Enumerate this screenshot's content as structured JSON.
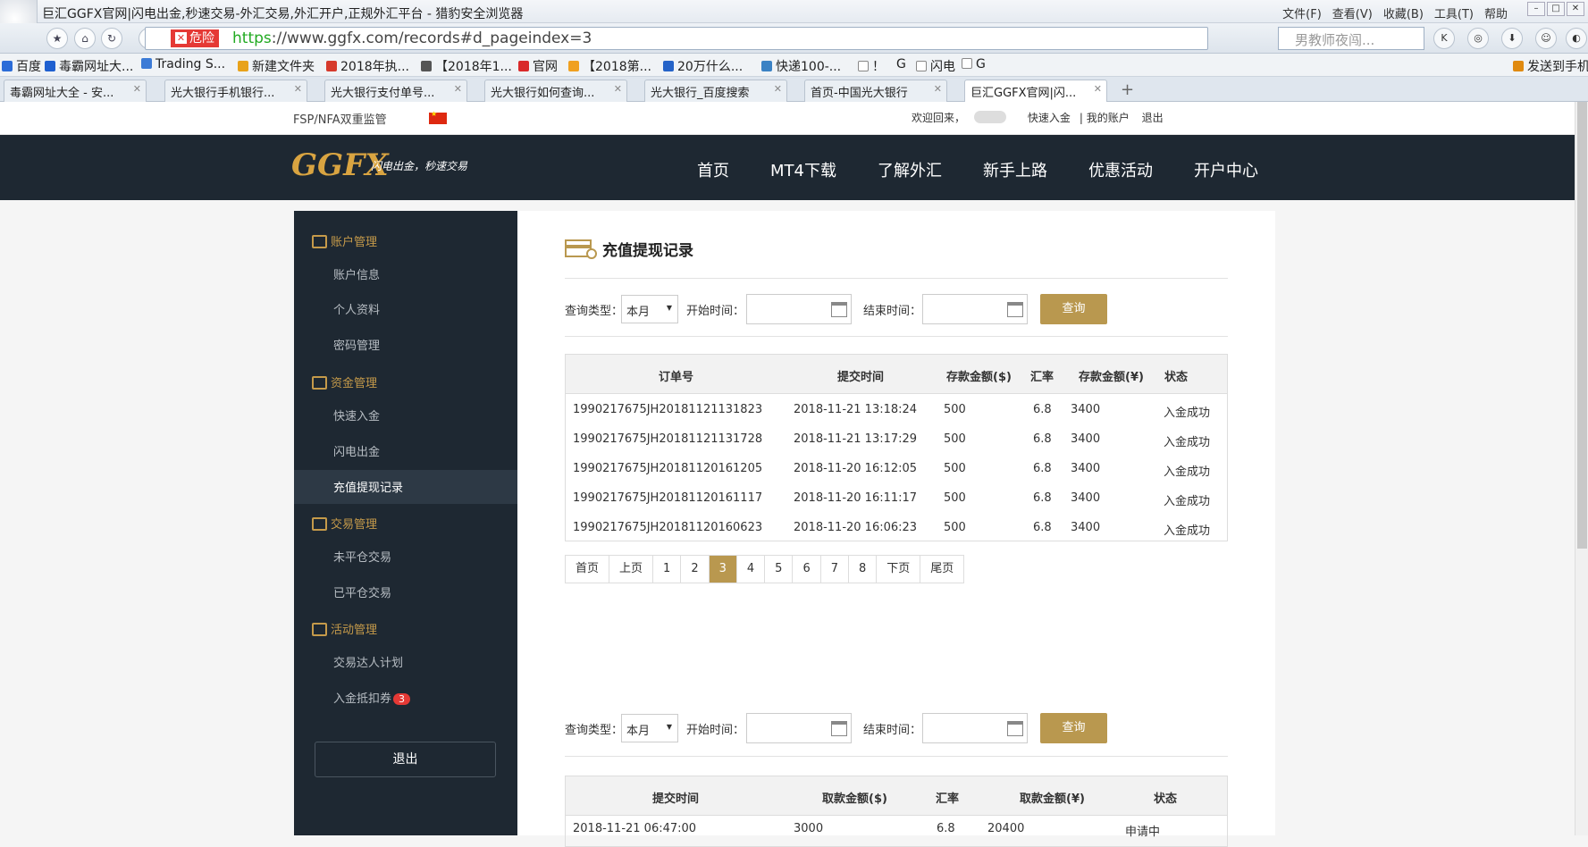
{
  "window": {
    "title": "巨汇GGFX官网|闪电出金,秒速交易-外汇交易,外汇开户,正规外汇平台 - 猎豹安全浏览器",
    "menu": [
      "文件(F)",
      "查看(V)",
      "收藏(B)",
      "工具(T)",
      "帮助"
    ]
  },
  "toolbar": {
    "danger_label": "危险",
    "url_scheme": "https",
    "url_rest": "://www.ggfx.com/records#d_pageindex=3",
    "search_placeholder": "男教师夜闯..."
  },
  "bookmarks": [
    "百度",
    "毒霸网址大...",
    "Trading S...",
    "新建文件夹",
    "2018年执...",
    "【2018年1...",
    "官网",
    "【2018第...",
    "20万什么...",
    "快递100-...",
    "！",
    "G",
    "闪电",
    "G",
    "发送到手机"
  ],
  "tabs": [
    {
      "label": "毒霸网址大全 - 安..."
    },
    {
      "label": "光大银行手机银行..."
    },
    {
      "label": "光大银行支付单号..."
    },
    {
      "label": "光大银行如何查询..."
    },
    {
      "label": "光大银行_百度搜索"
    },
    {
      "label": "首页-中国光大银行"
    },
    {
      "label": "巨汇GGFX官网|闪..."
    }
  ],
  "topstrip": {
    "regulation": "FSP/NFA双重监管",
    "welcome": "欢迎回来，",
    "quick_deposit": "快速入金",
    "my_account": "我的账户",
    "logout": "退出"
  },
  "brand": {
    "logo": "GGFX",
    "slogan": "闪电出金，秒速交易"
  },
  "mainnav": [
    "首页",
    "MT4下载",
    "了解外汇",
    "新手上路",
    "优惠活动",
    "开户中心"
  ],
  "sidebar": {
    "sections": [
      {
        "title": "账户管理",
        "items": [
          "账户信息",
          "个人资料",
          "密码管理"
        ]
      },
      {
        "title": "资金管理",
        "items": [
          "快速入金",
          "闪电出金",
          "充值提现记录"
        ]
      },
      {
        "title": "交易管理",
        "items": [
          "未平仓交易",
          "已平仓交易"
        ]
      },
      {
        "title": "活动管理",
        "items": [
          "交易达人计划",
          "入金抵扣券"
        ]
      }
    ],
    "badge": "3",
    "logout": "退出"
  },
  "content": {
    "title": "充值提现记录",
    "form": {
      "type_label": "查询类型：",
      "type_value": "本月",
      "start_label": "开始时间：",
      "end_label": "结束时间：",
      "query": "查询"
    },
    "deposit_table": {
      "headers": [
        "订单号",
        "提交时间",
        "存款金额($)",
        "汇率",
        "存款金额(¥)",
        "状态"
      ],
      "rows": [
        [
          "1990217675JH20181121131823",
          "2018-11-21 13:18:24",
          "500",
          "6.8",
          "3400",
          "入金成功"
        ],
        [
          "1990217675JH20181121131728",
          "2018-11-21 13:17:29",
          "500",
          "6.8",
          "3400",
          "入金成功"
        ],
        [
          "1990217675JH20181120161205",
          "2018-11-20 16:12:05",
          "500",
          "6.8",
          "3400",
          "入金成功"
        ],
        [
          "1990217675JH20181120161117",
          "2018-11-20 16:11:17",
          "500",
          "6.8",
          "3400",
          "入金成功"
        ],
        [
          "1990217675JH20181120160623",
          "2018-11-20 16:06:23",
          "500",
          "6.8",
          "3400",
          "入金成功"
        ]
      ]
    },
    "pager": [
      "首页",
      "上页",
      "1",
      "2",
      "3",
      "4",
      "5",
      "6",
      "7",
      "8",
      "下页",
      "尾页"
    ],
    "current_page": "3",
    "withdraw_table": {
      "headers": [
        "提交时间",
        "取款金额($)",
        "汇率",
        "取款金额(¥)",
        "状态"
      ],
      "rows": [
        [
          "2018-11-21 06:47:00",
          "3000",
          "6.8",
          "20400",
          "申请中"
        ]
      ]
    }
  },
  "colors": {
    "accent": "#b9984f",
    "header": "#1e2832",
    "danger": "#e53935"
  }
}
